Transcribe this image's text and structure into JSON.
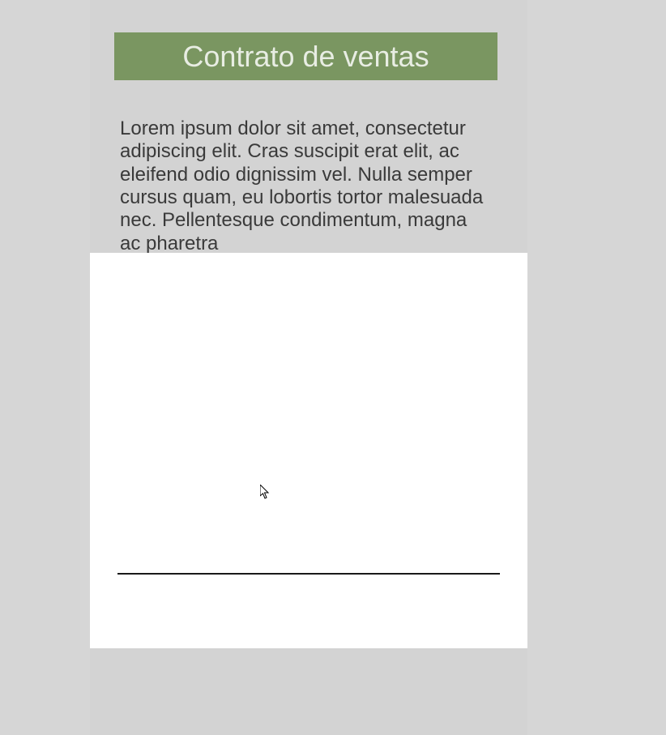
{
  "document": {
    "title": "Contrato de ventas",
    "body_text": "Lorem ipsum dolor sit amet, consectetur adipiscing elit. Cras suscipit erat elit, ac eleifend odio dignissim vel. Nulla semper cursus quam, eu lobortis tortor malesuada nec. Pellentesque condimentum, magna ac pharetra"
  }
}
